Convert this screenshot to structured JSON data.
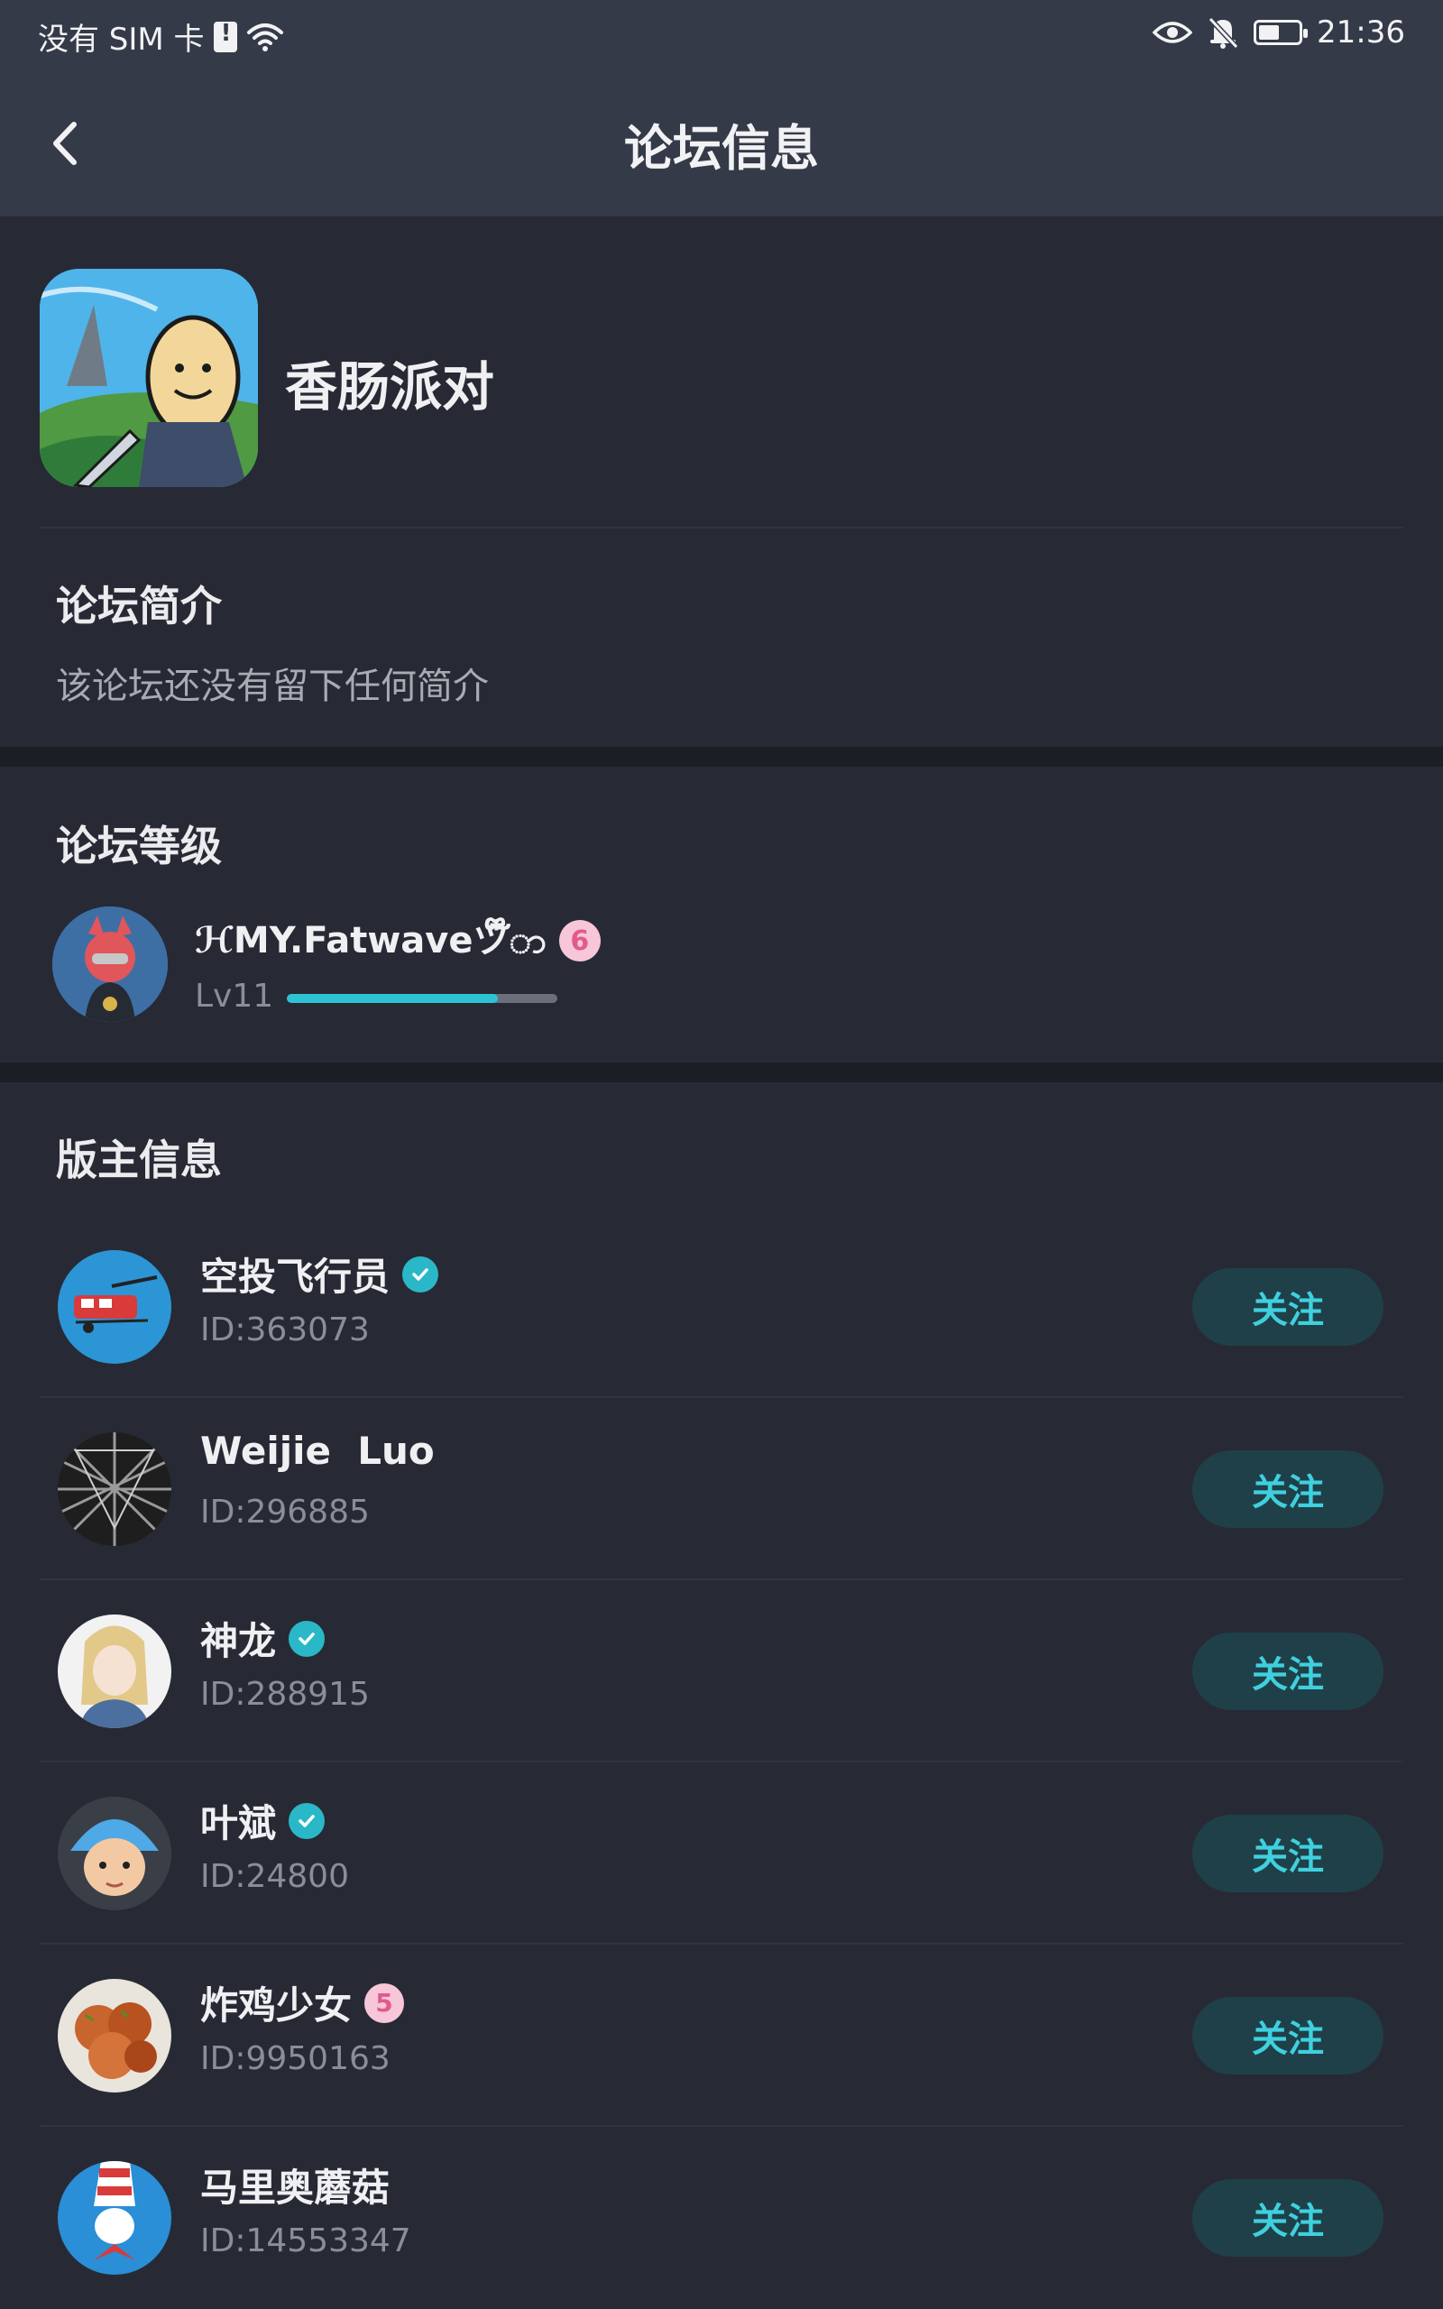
{
  "status_bar": {
    "carrier": "没有 SIM 卡",
    "time": "21:36",
    "battery_level": 0.5
  },
  "header": {
    "title": "论坛信息"
  },
  "forum": {
    "name": "香肠派对"
  },
  "intro": {
    "title": "论坛简介",
    "text": "该论坛还没有留下任何简介"
  },
  "level": {
    "title": "论坛等级",
    "user_name": "ℋMY.Fatwaveツ໊໋໊ာ",
    "badge": "6",
    "lv_label": "Lv11",
    "progress": 0.78
  },
  "moderators": {
    "title": "版主信息",
    "follow_label": "关注",
    "items": [
      {
        "name": "空投飞行员",
        "id": "ID:363073",
        "badge": "verified"
      },
      {
        "name": "Weijie  Luo",
        "id": "ID:296885",
        "badge": "none"
      },
      {
        "name": "神龙",
        "id": "ID:288915",
        "badge": "verified"
      },
      {
        "name": "叶斌",
        "id": "ID:24800",
        "badge": "verified"
      },
      {
        "name": "炸鸡少女",
        "id": "ID:9950163",
        "badge": "5"
      },
      {
        "name": "马里奥蘑菇",
        "id": "ID:14553347",
        "badge": "none"
      }
    ]
  },
  "colors": {
    "background": "#272a35",
    "header": "#353a48",
    "accent": "#2ec3d4",
    "follow_bg": "#1f4049"
  }
}
